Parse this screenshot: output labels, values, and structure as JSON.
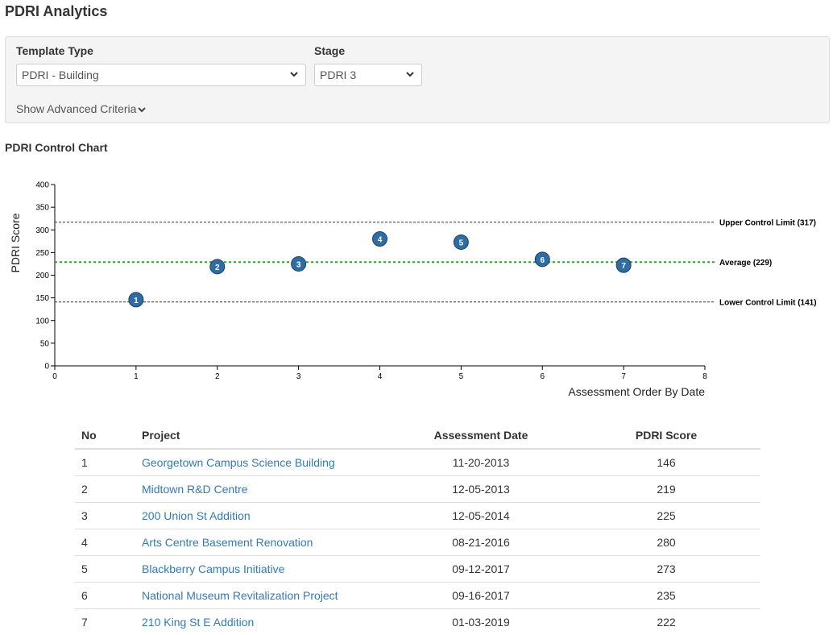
{
  "page": {
    "title": "PDRI Analytics"
  },
  "filters": {
    "template_type": {
      "label": "Template Type",
      "value": "PDRI - Building"
    },
    "stage": {
      "label": "Stage",
      "value": "PDRI 3"
    },
    "advanced_link": "Show Advanced Criteria"
  },
  "chart_section": {
    "title": "PDRI Control Chart"
  },
  "chart_data": {
    "type": "scatter",
    "title": "PDRI Control Chart",
    "xlabel": "Assessment Order By Date",
    "ylabel": "PDRI Score",
    "xlim": [
      0,
      8
    ],
    "ylim": [
      0,
      400
    ],
    "x_ticks": [
      "0",
      "1",
      "2",
      "3",
      "4",
      "5",
      "6",
      "7",
      "8"
    ],
    "y_ticks": [
      "0",
      "50",
      "100",
      "150",
      "200",
      "250",
      "300",
      "350",
      "400"
    ],
    "grid": false,
    "points": [
      {
        "x": 1,
        "y": 146,
        "label": "1"
      },
      {
        "x": 2,
        "y": 219,
        "label": "2"
      },
      {
        "x": 3,
        "y": 225,
        "label": "3"
      },
      {
        "x": 4,
        "y": 280,
        "label": "4"
      },
      {
        "x": 5,
        "y": 273,
        "label": "5"
      },
      {
        "x": 6,
        "y": 235,
        "label": "6"
      },
      {
        "x": 7,
        "y": 222,
        "label": "7"
      }
    ],
    "reference_lines": [
      {
        "name": "ucl",
        "value": 317,
        "label": "Upper Control Limit (317)",
        "color": "#333333"
      },
      {
        "name": "average",
        "value": 229,
        "label": "Average (229)",
        "color": "#22aa22"
      },
      {
        "name": "lcl",
        "value": 141,
        "label": "Lower Control Limit (141)",
        "color": "#333333"
      }
    ],
    "point_color": "#2e6da4"
  },
  "table": {
    "headers": {
      "no": "No",
      "project": "Project",
      "date": "Assessment Date",
      "score": "PDRI Score"
    },
    "rows": [
      {
        "no": "1",
        "project": "Georgetown Campus Science Building",
        "date": "11-20-2013",
        "score": "146"
      },
      {
        "no": "2",
        "project": "Midtown R&D Centre",
        "date": "12-05-2013",
        "score": "219"
      },
      {
        "no": "3",
        "project": "200 Union St Addition",
        "date": "12-05-2014",
        "score": "225"
      },
      {
        "no": "4",
        "project": "Arts Centre Basement Renovation",
        "date": "08-21-2016",
        "score": "280"
      },
      {
        "no": "5",
        "project": "Blackberry Campus Initiative",
        "date": "09-12-2017",
        "score": "273"
      },
      {
        "no": "6",
        "project": "National Museum Revitalization Project",
        "date": "09-16-2017",
        "score": "235"
      },
      {
        "no": "7",
        "project": "210 King St E Addition",
        "date": "01-03-2019",
        "score": "222"
      }
    ]
  }
}
